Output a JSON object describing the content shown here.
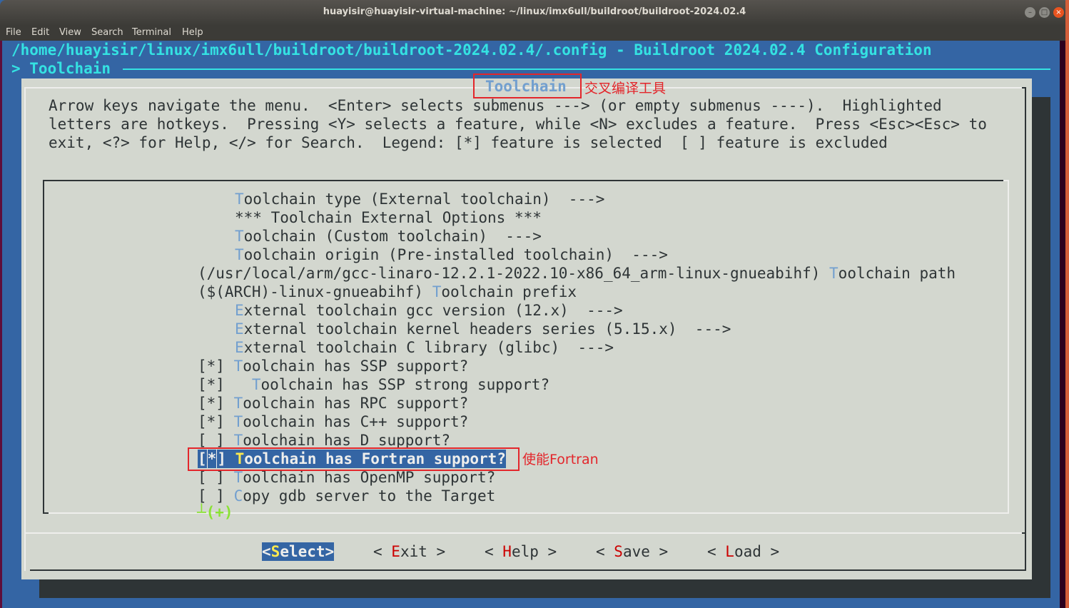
{
  "window": {
    "title": "huayisir@huayisir-virtual-machine: ~/linux/imx6ull/buildroot/buildroot-2024.02.4",
    "controls": {
      "minimize": "–",
      "maximize": "□",
      "close": "×"
    }
  },
  "menubar": [
    "File",
    "Edit",
    "View",
    "Search",
    "Terminal",
    "Help"
  ],
  "header": {
    "config_path": "/home/huayisir/linux/imx6ull/buildroot/buildroot-2024.02.4/.config - Buildroot 2024.02.4 Configuration",
    "breadcrumb": "> Toolchain"
  },
  "dialog": {
    "title": "Toolchain",
    "help_lines": [
      "Arrow keys navigate the menu.  <Enter> selects submenus ---> (or empty submenus ----).  Highlighted",
      "letters are hotkeys.  Pressing <Y> selects a feature, while <N> excludes a feature.  Press <Esc><Esc> to",
      "exit, <?> for Help, </> for Search.  Legend: [*] feature is selected  [ ] feature is excluded"
    ],
    "items": [
      {
        "prefix": "    ",
        "hotkey": "T",
        "rest": "oolchain type (External toolchain)  --->"
      },
      {
        "prefix": "    ",
        "hotkey": "",
        "rest": "*** Toolchain External Options ***"
      },
      {
        "prefix": "    ",
        "hotkey": "T",
        "rest": "oolchain (Custom toolchain)  --->"
      },
      {
        "prefix": "    ",
        "hotkey": "T",
        "rest": "oolchain origin (Pre-installed toolchain)  --->"
      },
      {
        "prefix": "(/usr/local/arm/gcc-linaro-12.2.1-2022.10-x86_64_arm-linux-gnueabihf) ",
        "hotkey": "T",
        "rest": "oolchain path"
      },
      {
        "prefix": "($(ARCH)-linux-gnueabihf) ",
        "hotkey": "T",
        "rest": "oolchain prefix"
      },
      {
        "prefix": "    ",
        "hotkey": "E",
        "rest": "xternal toolchain gcc version (12.x)  --->"
      },
      {
        "prefix": "    ",
        "hotkey": "E",
        "rest": "xternal toolchain kernel headers series (5.15.x)  --->"
      },
      {
        "prefix": "    ",
        "hotkey": "E",
        "rest": "xternal toolchain C library (glibc)  --->"
      },
      {
        "prefix": "[*] ",
        "hotkey": "T",
        "rest": "oolchain has SSP support?"
      },
      {
        "prefix": "[*]   ",
        "hotkey": "T",
        "rest": "oolchain has SSP strong support?"
      },
      {
        "prefix": "[*] ",
        "hotkey": "T",
        "rest": "oolchain has RPC support?"
      },
      {
        "prefix": "[*] ",
        "hotkey": "T",
        "rest": "oolchain has C++ support?"
      },
      {
        "prefix": "[ ] ",
        "hotkey": "T",
        "rest": "oolchain has D support?"
      },
      {
        "prefix_a": "[",
        "prefix_cursor": "*",
        "prefix_b": "] ",
        "hotkey": "T",
        "rest": "oolchain has Fortran support?",
        "selected": true
      },
      {
        "prefix": "[ ] ",
        "hotkey": "T",
        "rest": "oolchain has OpenMP support?"
      },
      {
        "prefix": "[ ] ",
        "hotkey": "C",
        "rest": "opy gdb server to the Target"
      }
    ],
    "more_indicator": "┴(+)",
    "buttons": [
      {
        "open": "<",
        "key": "S",
        "rest": "elect",
        "close": ">",
        "active": true
      },
      {
        "open": "< ",
        "key": "E",
        "rest": "xit",
        "close": " >"
      },
      {
        "open": "< ",
        "key": "H",
        "rest": "elp",
        "close": " >"
      },
      {
        "open": "< ",
        "key": "S",
        "rest": "ave",
        "close": " >"
      },
      {
        "open": "< ",
        "key": "L",
        "rest": "oad",
        "close": " >"
      }
    ]
  },
  "annotations": {
    "title_note": "交叉编译工具",
    "fortran_note": "使能Fortran",
    "color": "#e3262b"
  }
}
